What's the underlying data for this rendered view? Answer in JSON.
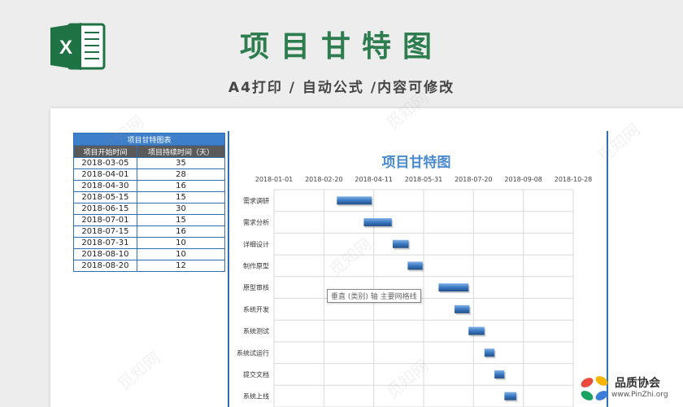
{
  "header": {
    "title": "项目甘特图",
    "subtitle": "A4打印 / 自动公式 /内容可修改",
    "logo_letter": "X"
  },
  "table": {
    "caption": "项目甘特图表",
    "col_start": "项目开始时间",
    "col_duration": "项目持续时间（天）",
    "rows": [
      {
        "start": "2018-03-05",
        "days": "35"
      },
      {
        "start": "2018-04-01",
        "days": "28"
      },
      {
        "start": "2018-04-30",
        "days": "16"
      },
      {
        "start": "2018-05-15",
        "days": "15"
      },
      {
        "start": "2018-06-15",
        "days": "30"
      },
      {
        "start": "2018-07-01",
        "days": "15"
      },
      {
        "start": "2018-07-15",
        "days": "16"
      },
      {
        "start": "2018-07-31",
        "days": "10"
      },
      {
        "start": "2018-08-10",
        "days": "10"
      },
      {
        "start": "2018-08-20",
        "days": "12"
      }
    ]
  },
  "chart_data": {
    "type": "bar",
    "orientation": "horizontal-gantt",
    "title": "项目甘特图",
    "xticks": [
      "2018-01-01",
      "2018-02-20",
      "2018-04-11",
      "2018-05-31",
      "2018-07-20",
      "2018-09-08",
      "2018-10-28"
    ],
    "xlim": [
      "2018-01-01",
      "2018-10-28"
    ],
    "categories": [
      "需求调研",
      "需求分析",
      "详细设计",
      "制作原型",
      "原型审核",
      "系统开发",
      "系统测试",
      "系统试运行",
      "提交文档",
      "系统上线"
    ],
    "start": [
      "2018-03-05",
      "2018-04-01",
      "2018-04-30",
      "2018-05-15",
      "2018-06-15",
      "2018-07-01",
      "2018-07-15",
      "2018-07-31",
      "2018-08-10",
      "2018-08-20"
    ],
    "duration_days": [
      35,
      28,
      16,
      15,
      30,
      15,
      16,
      10,
      10,
      12
    ],
    "bar_color": "#3a78c2",
    "grid": true
  },
  "tooltip": "垂直 (类别) 轴 主要网格线",
  "watermark": "觅知网",
  "badge": {
    "name": "品质协会",
    "url": "www.PinZhi.org"
  }
}
